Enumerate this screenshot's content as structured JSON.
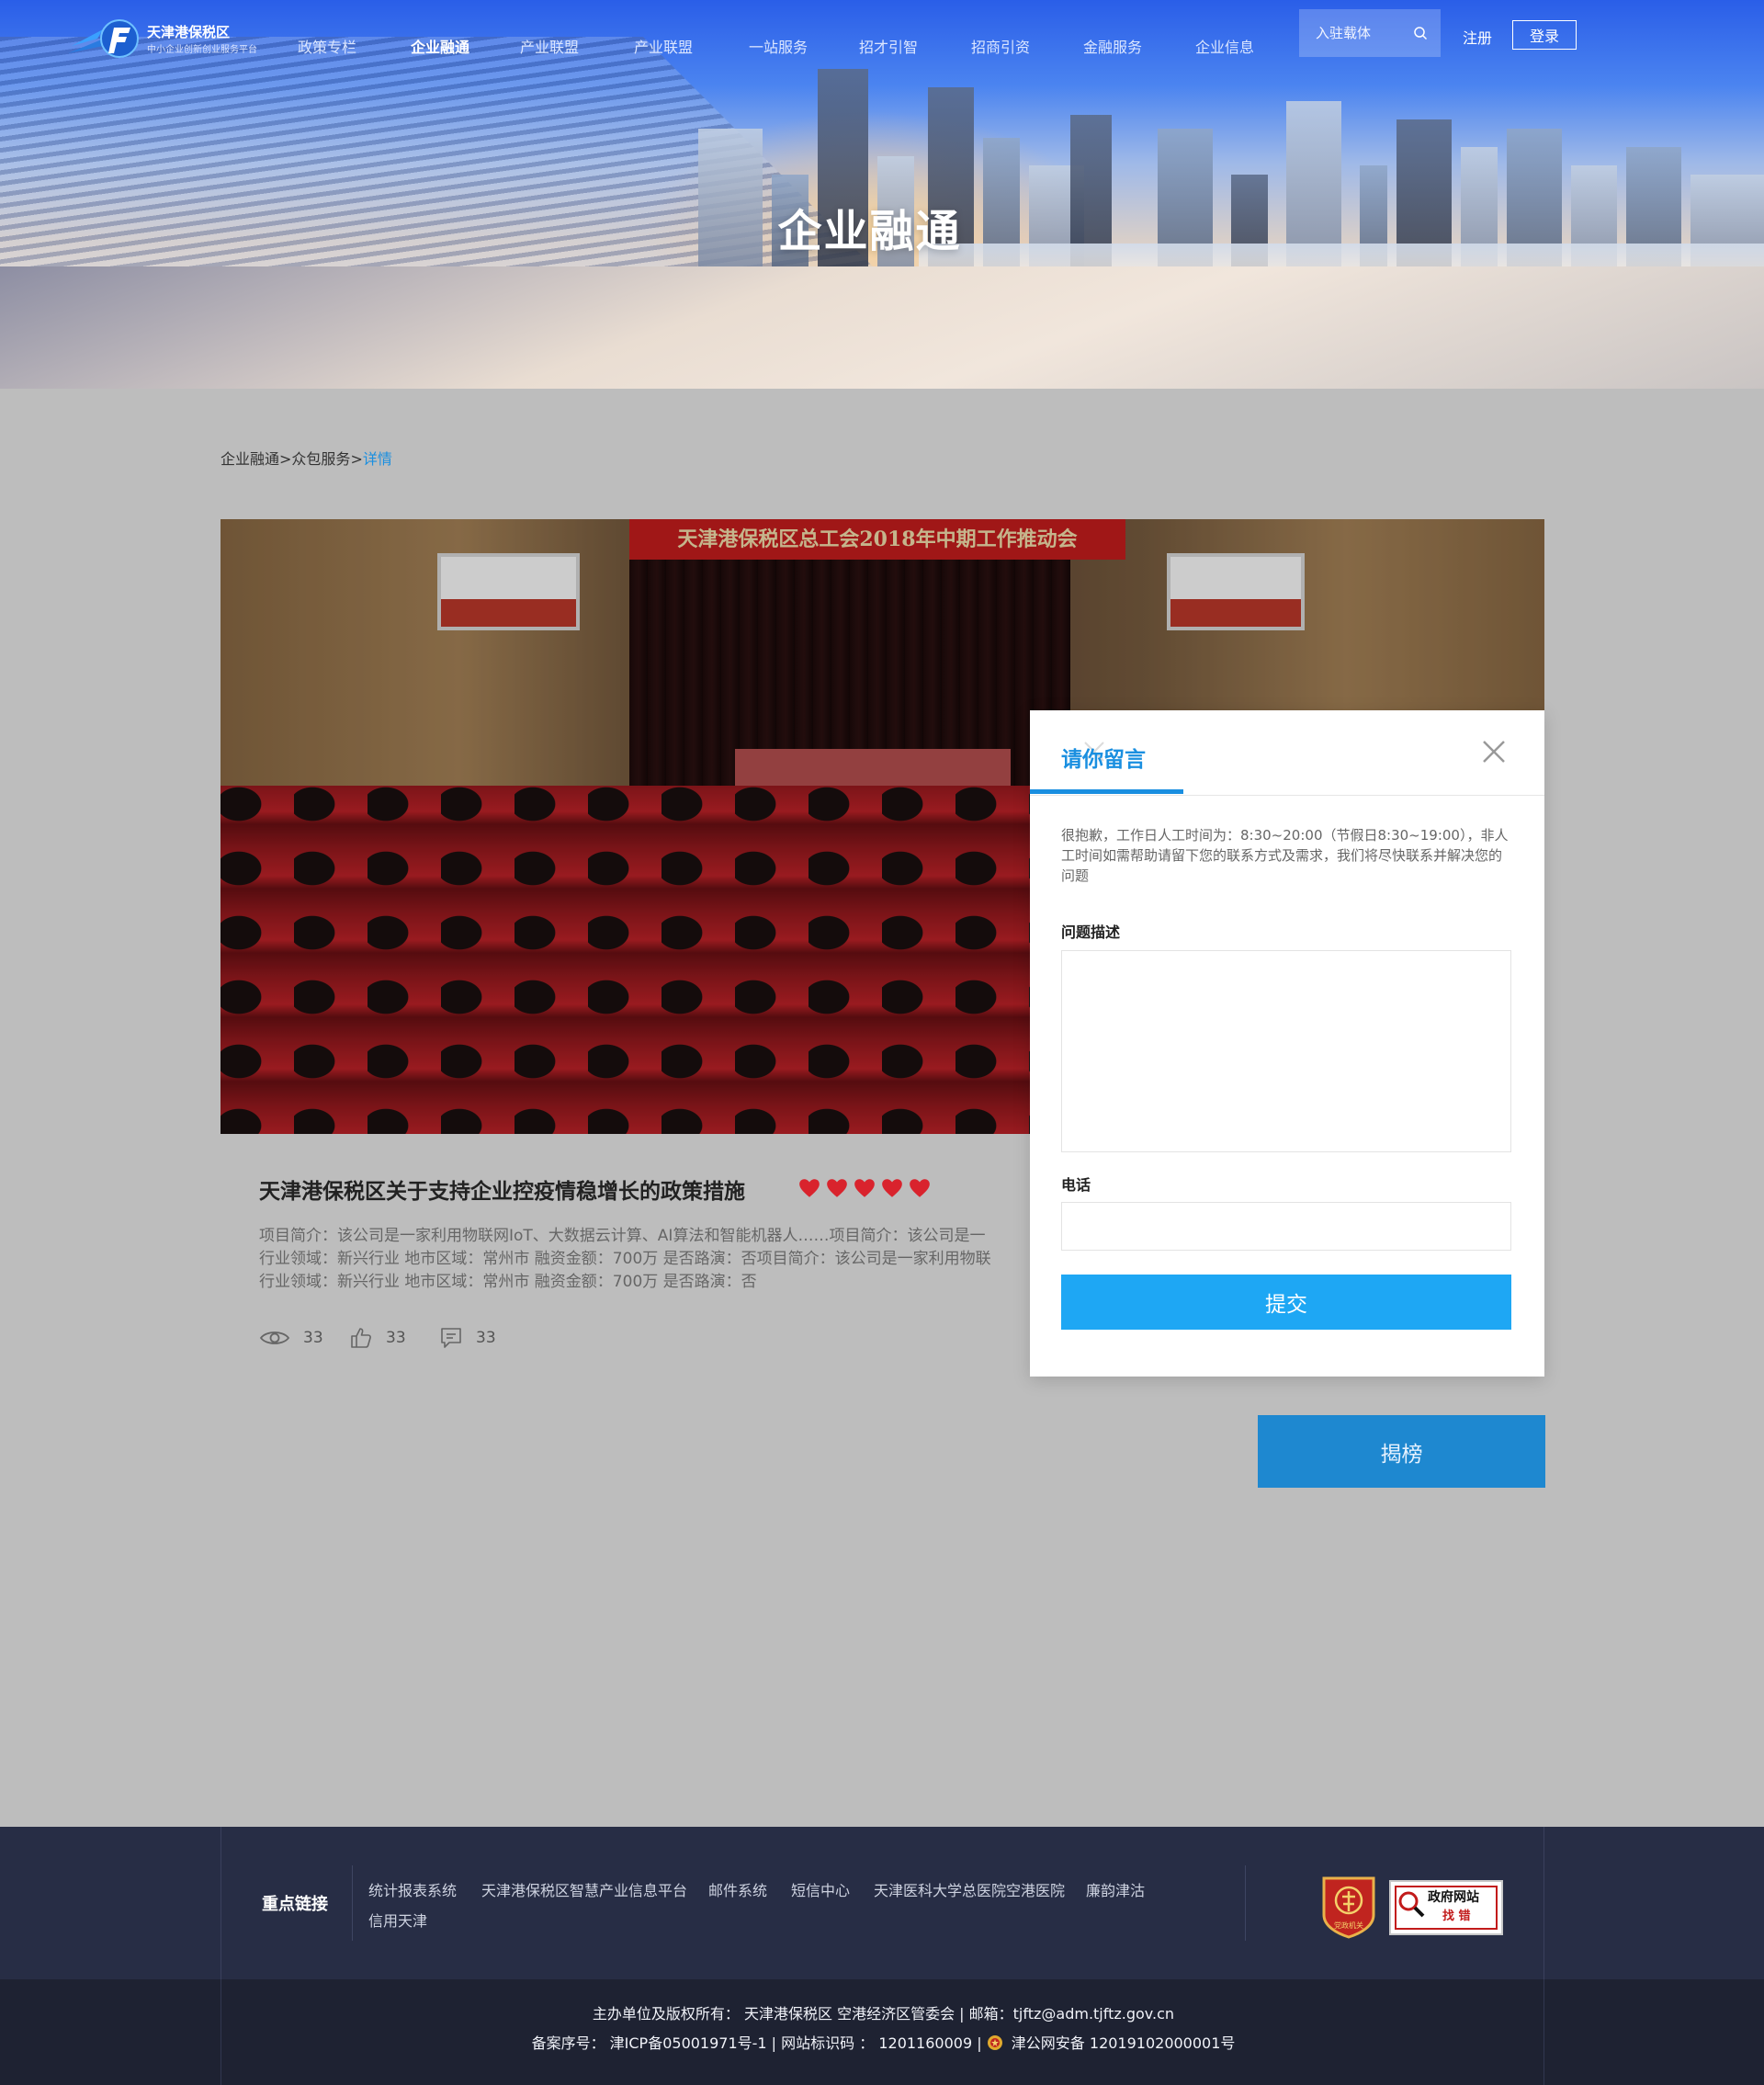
{
  "header": {
    "logo_title": "天津港保税区",
    "logo_subtitle": "中小企业创新创业服务平台",
    "nav": [
      {
        "label": "政策专栏",
        "active": false
      },
      {
        "label": "企业融通",
        "active": true
      },
      {
        "label": "产业联盟",
        "active": false
      },
      {
        "label": "产业联盟",
        "active": false
      },
      {
        "label": "一站服务",
        "active": false
      },
      {
        "label": "招才引智",
        "active": false
      },
      {
        "label": "招商引资",
        "active": false
      },
      {
        "label": "金融服务",
        "active": false
      },
      {
        "label": "企业信息",
        "active": false
      }
    ],
    "search_placeholder": "入驻载体",
    "register_label": "注册",
    "login_label": "登录"
  },
  "hero": {
    "title": "企业融通"
  },
  "breadcrumb": {
    "items": [
      "企业融通",
      "众包服务"
    ],
    "separator": ">",
    "current": "详情"
  },
  "photo": {
    "banner_text": "天津港保税区总工会2018年中期工作推动会"
  },
  "article": {
    "title": "天津港保税区关于支持企业控疫情稳增长的政策措施",
    "rating": 5,
    "description_lines": [
      "项目简介：该公司是一家利用物联网IoT、大数据云计算、AI算法和智能机器人……项目简介：该公司是一",
      "行业领域：新兴行业 地市区域：常州市 融资金额：700万 是否路演：否项目简介：该公司是一家利用物联",
      "行业领域：新兴行业 地市区域：常州市 融资金额：700万 是否路演：否"
    ],
    "views": "33",
    "likes": "33",
    "comments": "33"
  },
  "modal": {
    "tab_label": "请你留言",
    "notice": "很抱歉，工作日人工时间为：8:30~20:00（节假日8:30~19:00），非人工时间如需帮助请留下您的联系方式及需求，我们将尽快联系并解决您的问题",
    "description_label": "问题描述",
    "description_value": "",
    "phone_label": "电话",
    "phone_value": "",
    "submit_label": "提交"
  },
  "claim_button_label": "揭榜",
  "footer": {
    "links_heading": "重点链接",
    "links": [
      "统计报表系统",
      "天津港保税区智慧产业信息平台",
      "邮件系统",
      "短信中心",
      "天津医科大学总医院空港医院",
      "廉韵津沽",
      "信用天津"
    ],
    "party_badge_text": "党政机关",
    "gov_badge_line1": "政府网站",
    "gov_badge_line2": "找 错",
    "copyright_line": "主办单位及版权所有：  天津港保税区 空港经济区管委会  |  邮箱：tjftz@adm.tjftz.gov.cn",
    "record_line_prefix": "备案序号：  津ICP备05001971号-1  |  网站标识码 ：  1201160009  |",
    "record_line_police": "津公网安备 12019102000001号"
  },
  "colors": {
    "accent": "#1a8fe0",
    "submit": "#1ea7f4",
    "claim": "#1e88d0",
    "heart": "#d9232d",
    "footer_top": "#272d45",
    "footer_bottom": "#1e2232",
    "page_bg": "#bdbdbd"
  }
}
